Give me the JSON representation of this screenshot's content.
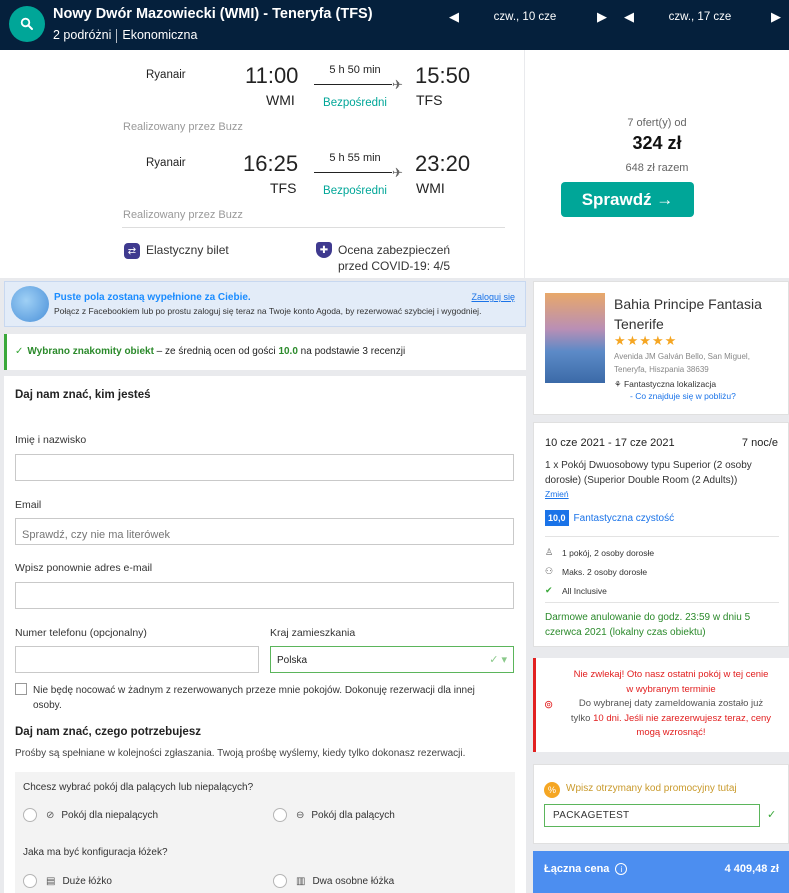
{
  "header": {
    "route": "Nowy Dwór Mazowiecki (WMI) - Teneryfa (TFS)",
    "travellers": "2 podróżni",
    "cabin": "Ekonomiczna",
    "depart_date": "czw., 10 cze",
    "return_date": "czw., 17 cze",
    "prev_icon": "◀",
    "next_icon": "▶",
    "search_icon": "search-icon"
  },
  "flights": [
    {
      "airline": "Ryanair",
      "dep_time": "11:00",
      "dep_code": "WMI",
      "duration": "5 h 50 min",
      "stops": "Bezpośredni",
      "arr_time": "15:50",
      "arr_code": "TFS",
      "operated_by": "Realizowany przez Buzz"
    },
    {
      "airline": "Ryanair",
      "dep_time": "16:25",
      "dep_code": "TFS",
      "duration": "5 h 55 min",
      "stops": "Bezpośredni",
      "arr_time": "23:20",
      "arr_code": "WMI",
      "operated_by": "Realizowany przez Buzz"
    }
  ],
  "flight_features": {
    "flexible": "Elastyczny bilet",
    "covid_line1": "Ocena zabezpieczeń",
    "covid_line2": "przed COVID-19: 4/5"
  },
  "deal": {
    "offers": "7 ofert(y) od",
    "price": "324 zł",
    "total": "648 zł razem",
    "cta": "Sprawdź →"
  },
  "facebook": {
    "title": "Puste pola zostaną wypełnione za Ciebie.",
    "text": "Połącz z Facebookiem lub po prostu zaloguj się teraz na Twoje konto Agoda, by rezerwować szybciej i wygodniej.",
    "login": "Zaloguj się"
  },
  "good_choice": {
    "lead": "Wybrano znakomity obiekt",
    "middle": " – ze średnią ocen od gości ",
    "score": "10.0",
    "tail": " na podstawie 3 recenzji"
  },
  "form": {
    "heading": "Daj nam znać, kim jesteś",
    "name_label": "Imię i nazwisko",
    "name_value": "",
    "email_label": "Email",
    "email_placeholder": "Sprawdź, czy nie ma literówek",
    "email2_label": "Wpisz ponownie adres e-mail",
    "phone_label": "Numer telefonu (opcjonalny)",
    "country_label": "Kraj zamieszkania",
    "country_value": "Polska",
    "not_staying": "Nie będę nocować w żadnym z rezerwowanych przeze mnie pokojów. Dokonuję rezerwacji dla innej osoby.",
    "needs_heading": "Daj nam znać, czego potrzebujesz",
    "needs_note": "Prośby są spełniane w kolejności zgłaszania. Twoją prośbę wyślemy, kiedy tylko dokonasz rezerwacji.",
    "smoking_q": "Chcesz wybrać pokój dla palących lub niepalących?",
    "non_smoking": "Pokój dla niepalących",
    "smoking": "Pokój dla palących",
    "beds_q": "Jaka ma być konfiguracja łóżek?",
    "double_bed": "Duże łóżko",
    "twin_beds": "Dwa osobne łóżka"
  },
  "hotel": {
    "name_line1": "Bahia Principe Fantasia",
    "name_line2": "Tenerife",
    "stars": "★★★★★",
    "address": "Avenida JM Galván Bello, San Miguel, Teneryfa, Hiszpania 38639",
    "location_badge": "Fantastyczna lokalizacja",
    "nearby": "- Co znajduje się w pobliżu?"
  },
  "stay": {
    "dates": "10 cze 2021 - 17 cze 2021",
    "nights": "7 noc/e",
    "room": "1 x Pokój Dwuosobowy typu Superior (2 osoby dorosłe) (Superior Double Room (2 Adults))",
    "change": "Zmień",
    "clean_score": "10,0",
    "clean_label": "Fantastyczna czystość",
    "occupancy": "1 pokój, 2 osoby dorosłe",
    "max": "Maks. 2 osoby dorosłe",
    "board": "All Inclusive",
    "cancel": "Darmowe anulowanie do godz. 23:59 w dniu 5 czerwca 2021 (lokalny czas obiektu)"
  },
  "urgency": {
    "l1": "Nie zwlekaj! Oto nasz ostatni pokój w tej cenie",
    "l2": "w wybranym terminie",
    "l3": "Do wybranej daty zameldowania zostało już",
    "l4_a": "tylko ",
    "l4_days": "10 dni",
    "l4_b": ". Jeśli nie zarezerwujesz teraz, ceny",
    "l5": "mogą wzrosnąć!"
  },
  "promo": {
    "label": "Wpisz otrzymany kod promocyjny tutaj",
    "code": "PACKAGETEST"
  },
  "total": {
    "label": "Łączna cena",
    "amount": "4 409,48 zł"
  }
}
